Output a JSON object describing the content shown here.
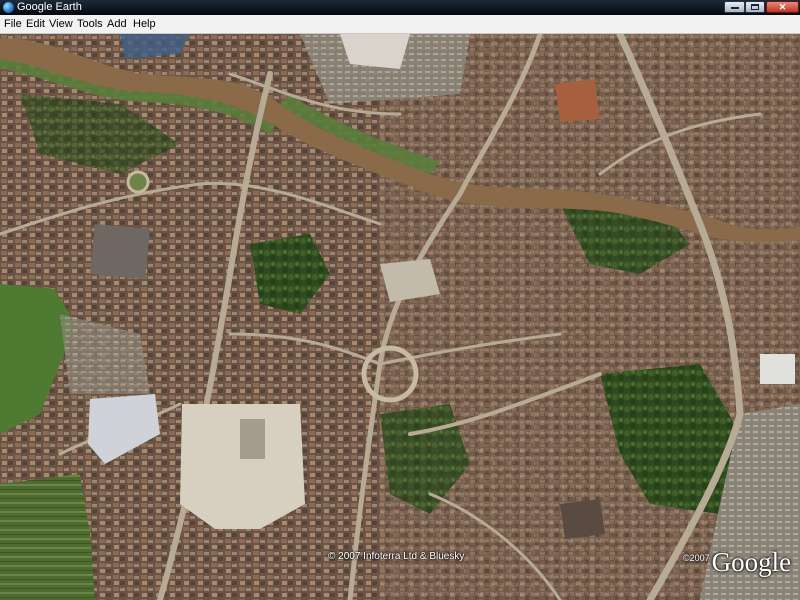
{
  "window": {
    "title": "Google Earth",
    "icons": {
      "app": "google-earth-globe-icon",
      "minimize": "minimize-icon",
      "maximize": "maximize-icon",
      "close": "close-icon"
    }
  },
  "menu": {
    "items": [
      "File",
      "Edit",
      "View",
      "Tools",
      "Add",
      "Help"
    ]
  },
  "map": {
    "copyright": "© 2007 Infoterra Ltd & Bluesky",
    "logo_prefix": "©2007",
    "logo": "Google",
    "colors": {
      "river": "#8a6a48",
      "grass": "#4f7a32",
      "roofs": "#7a5a45",
      "roads": "#b8ab95",
      "trees": "#2f4a1f"
    }
  }
}
